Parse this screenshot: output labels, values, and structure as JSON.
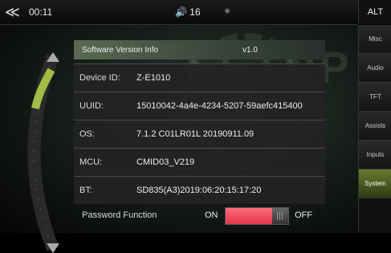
{
  "status": {
    "time": "00:11",
    "volume": "16",
    "alt_label": "ALT"
  },
  "background": {
    "watermark": "SETUP"
  },
  "header": {
    "label": "Software Version Info",
    "version": "v1.0"
  },
  "rows": [
    {
      "label": "Device ID:",
      "value": "Z-E1010"
    },
    {
      "label": "UUID:",
      "value": "15010042-4a4e-4234-5207-59aefc415400"
    },
    {
      "label": "OS:",
      "value": "7.1.2 C01LR01L 20190911.09"
    },
    {
      "label": "MCU:",
      "value": "CMID03_V219"
    },
    {
      "label": "BT:",
      "value": "SD835(A3)2019:06:20:15:17:20"
    }
  ],
  "password": {
    "label": "Password Function",
    "on_label": "ON",
    "off_label": "OFF",
    "state": "on"
  },
  "sidebar": {
    "items": [
      {
        "label": "Misc",
        "active": false
      },
      {
        "label": "Audio",
        "active": false
      },
      {
        "label": "TFT",
        "active": false
      },
      {
        "label": "Assists",
        "active": false
      },
      {
        "label": "Inputs",
        "active": false
      },
      {
        "label": "System",
        "active": true
      }
    ]
  },
  "colors": {
    "accent": "#6a7a30",
    "toggle_on": "#e23a4c"
  },
  "icons": {
    "back": "back-arrow-icon",
    "volume": "volume-icon",
    "bluetooth": "bluetooth-icon"
  }
}
